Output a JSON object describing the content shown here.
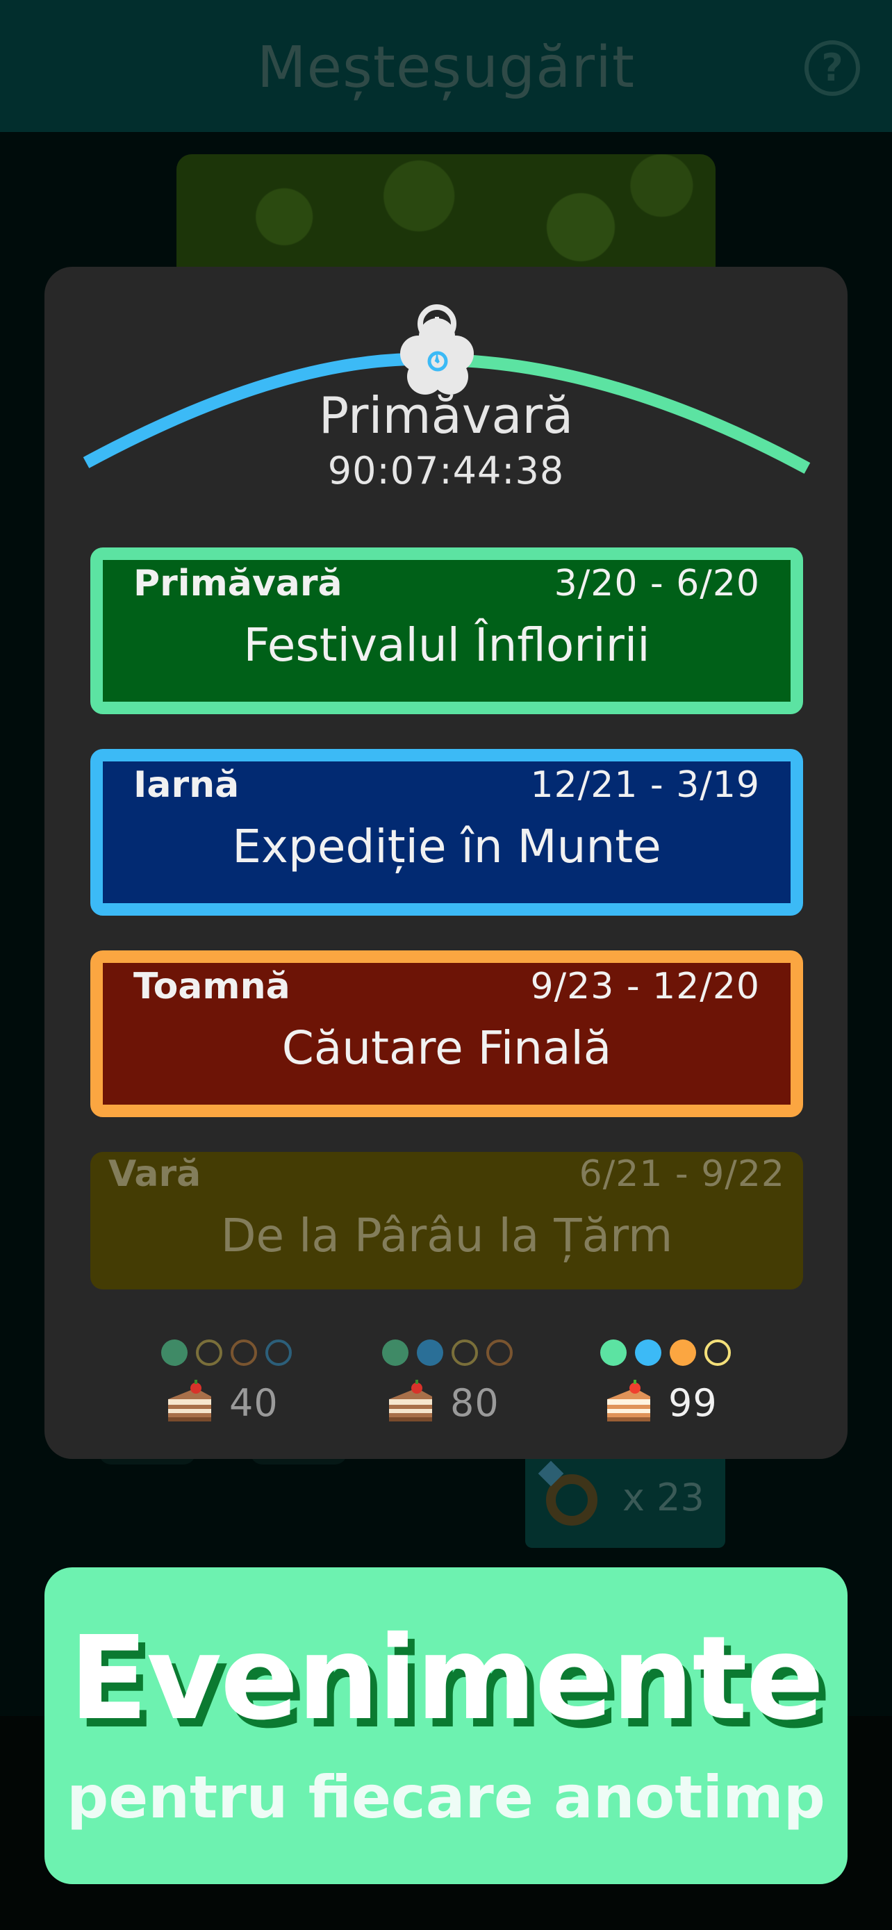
{
  "header": {
    "title": "Meșteșugărit",
    "help_icon": "question-circle-icon"
  },
  "background": {
    "item_count": "x 23"
  },
  "modal": {
    "current_season": "Primăvară",
    "countdown": "90:07:44:38",
    "events": [
      {
        "season": "Primăvară",
        "dates": "3/20 - 6/20",
        "name": "Festivalul Înfloririi",
        "border_color": "#5ce3a2",
        "fill_color": "#006018"
      },
      {
        "season": "Iarnă",
        "dates": "12/21 - 3/19",
        "name": "Expediție în Munte",
        "border_color": "#3cbaf6",
        "fill_color": "#022a72"
      },
      {
        "season": "Toamnă",
        "dates": "9/23 - 12/20",
        "name": "Căutare Finală",
        "border_color": "#fba641",
        "fill_color": "#6d1406"
      },
      {
        "season": "Vară",
        "dates": "6/21 - 9/22",
        "name": "De la Pârâu la Țărm",
        "border_color": "none",
        "fill_color": "#443c04"
      }
    ],
    "rewards": [
      {
        "value": "40",
        "icon": "cake-icon",
        "completed": 1
      },
      {
        "value": "80",
        "icon": "cake-icon",
        "completed": 2
      },
      {
        "value": "99",
        "icon": "cake-icon",
        "completed": 3
      }
    ]
  },
  "promo": {
    "title": "Evenimente",
    "subtitle": "pentru fiecare anotimp"
  },
  "colors": {
    "spring": "#5ce3a2",
    "winter": "#3cbaf6",
    "autumn": "#fba641",
    "summer": "#f4e07a",
    "panel": "#282828",
    "promo_bg": "#6df2b0",
    "promo_shadow": "#0b7a31"
  }
}
